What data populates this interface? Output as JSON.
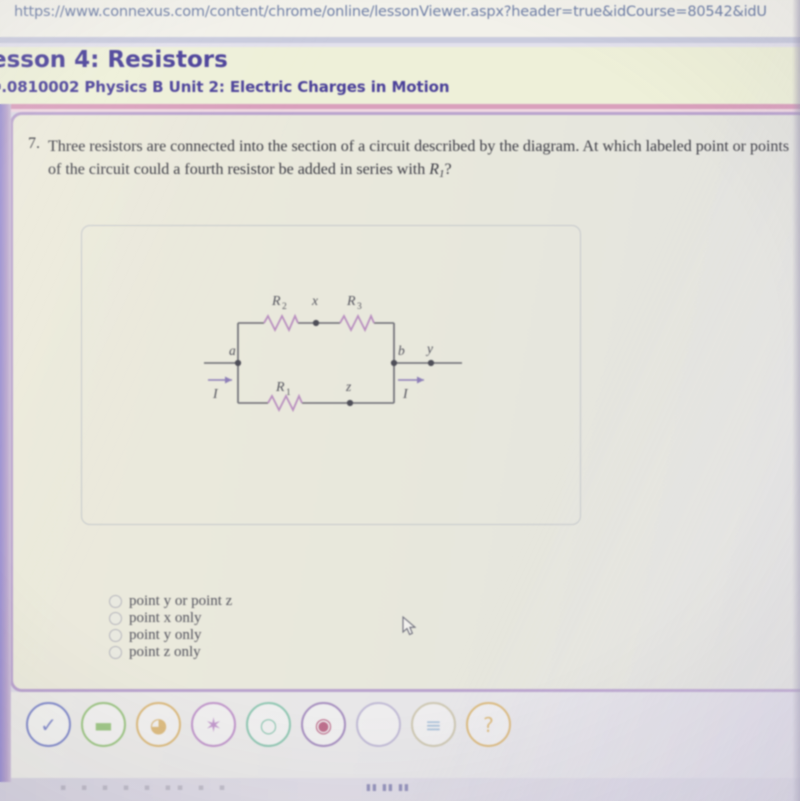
{
  "browser": {
    "url": "https://www.connexus.com/content/chrome/online/lessonViewer.aspx?header=true&idCourse=80542&idU"
  },
  "lesson": {
    "title": "esson 4: Resistors",
    "subtitle": "0.0810002 Physics B  Unit 2: Electric Charges in Motion"
  },
  "question": {
    "number": "7.",
    "text_part1": "Three resistors are connected into the section of a circuit described by the diagram. At which labeled point or points of the circuit could a fourth resistor be added in series with ",
    "variable": "R",
    "subscript": "1",
    "text_part2": "?"
  },
  "diagram": {
    "labels": {
      "r2": "R",
      "r2_sub": "2",
      "r3": "R",
      "r3_sub": "3",
      "r1": "R",
      "r1_sub": "1",
      "point_a": "a",
      "point_b": "b",
      "point_x": "x",
      "point_y": "y",
      "point_z": "z",
      "current_left": "I",
      "current_right": "I"
    },
    "colors": {
      "wire": "#6a6a72",
      "resistor": "#b98fc0",
      "label_text": "#5a5a66",
      "panel_border": "#c6c9cc"
    }
  },
  "choices": [
    {
      "label": "point y or point z",
      "selected": false
    },
    {
      "label": "point x only",
      "selected": false
    },
    {
      "label": "point y only",
      "selected": false
    },
    {
      "label": "point z only",
      "selected": false
    }
  ],
  "tray": {
    "icons": [
      {
        "name": "checkmark-icon",
        "glyph": "✓",
        "color": "#6f79c4"
      },
      {
        "name": "book-icon",
        "glyph": "▬",
        "color": "#8fbf72"
      },
      {
        "name": "hand-icon",
        "glyph": "◕",
        "color": "#d9b26a"
      },
      {
        "name": "star-icon",
        "glyph": "✶",
        "color": "#b987c6"
      },
      {
        "name": "lightbulb-icon",
        "glyph": "○",
        "color": "#7fc0a8"
      },
      {
        "name": "target-icon",
        "glyph": "◉",
        "color": "#b4567a"
      },
      {
        "name": "blank-icon",
        "glyph": "",
        "color": "#b9b2d2"
      },
      {
        "name": "note-icon",
        "glyph": "≡",
        "color": "#9fb9d6"
      },
      {
        "name": "help-icon",
        "glyph": "?",
        "color": "#d9b26a"
      }
    ]
  },
  "taskbar": {
    "ghost_text": "▪ ▪ ▪  ▪ ▪   ▪▪  ▪ ▪",
    "clock": "▮▮ ▮▮ ▮▮"
  },
  "theme": {
    "page_bg": "#e9e9dd",
    "header_bg": "#eef0d9",
    "header_text": "#4a4099",
    "url_text": "#6f7fa6",
    "rule_pink": "#d9a0bc",
    "card_border": "#b9a3cd",
    "body_text": "#3b3b44",
    "choice_text": "#55555f"
  }
}
